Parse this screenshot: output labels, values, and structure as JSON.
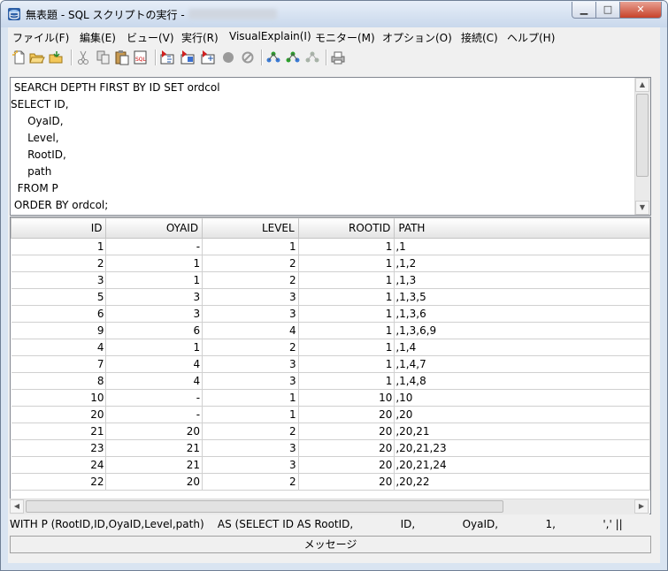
{
  "window": {
    "title": "無表題 - SQL スクリプトの実行 -",
    "min_glyph": "▁",
    "max_glyph": "□",
    "close_glyph": "✕"
  },
  "menu": [
    {
      "label": "ファイル(F)"
    },
    {
      "label": "編集(E)"
    },
    {
      "label": "ビュー(V)"
    },
    {
      "label": "実行(R)"
    },
    {
      "label": "VisualExplain(I)"
    },
    {
      "label": "モニター(M)"
    },
    {
      "label": "オプション(O)"
    },
    {
      "label": "接続(C)"
    },
    {
      "label": "ヘルプ(H)"
    }
  ],
  "toolbar": {
    "icons": [
      "new-file-icon",
      "open-folder-icon",
      "save-icon",
      "cut-icon",
      "copy-icon",
      "paste-icon",
      "paste-sql-icon",
      "run-all-icon",
      "run-selected-icon",
      "run-from-icon",
      "stop-icon",
      "cancel-icon",
      "explain-icon",
      "explain-all-icon",
      "explain-disabled-icon",
      "print-icon"
    ]
  },
  "editor": {
    "lines": [
      " SEARCH DEPTH FIRST BY ID SET ordcol",
      "SELECT ID,",
      "     OyaID,",
      "     Level,",
      "     RootID,",
      "     path",
      "  FROM P",
      " ORDER BY ordcol;"
    ]
  },
  "grid": {
    "columns": [
      "ID",
      "OYAID",
      "LEVEL",
      "ROOTID",
      "PATH"
    ],
    "rows": [
      [
        "1",
        "-",
        "1",
        "1",
        ",1"
      ],
      [
        "2",
        "1",
        "2",
        "1",
        ",1,2"
      ],
      [
        "3",
        "1",
        "2",
        "1",
        ",1,3"
      ],
      [
        "5",
        "3",
        "3",
        "1",
        ",1,3,5"
      ],
      [
        "6",
        "3",
        "3",
        "1",
        ",1,3,6"
      ],
      [
        "9",
        "6",
        "4",
        "1",
        ",1,3,6,9"
      ],
      [
        "4",
        "1",
        "2",
        "1",
        ",1,4"
      ],
      [
        "7",
        "4",
        "3",
        "1",
        ",1,4,7"
      ],
      [
        "8",
        "4",
        "3",
        "1",
        ",1,4,8"
      ],
      [
        "10",
        "-",
        "1",
        "10",
        ",10"
      ],
      [
        "20",
        "-",
        "1",
        "20",
        ",20"
      ],
      [
        "21",
        "20",
        "2",
        "20",
        ",20,21"
      ],
      [
        "23",
        "21",
        "3",
        "20",
        ",20,21,23"
      ],
      [
        "24",
        "21",
        "3",
        "20",
        ",20,21,24"
      ],
      [
        "22",
        "20",
        "2",
        "20",
        ",20,22"
      ]
    ]
  },
  "status_text": "WITH P (RootID,ID,OyaID,Level,path)    AS (SELECT ID AS RootID,              ID,              OyaID,              1,              ',' ||",
  "message_button": "メッセージ"
}
